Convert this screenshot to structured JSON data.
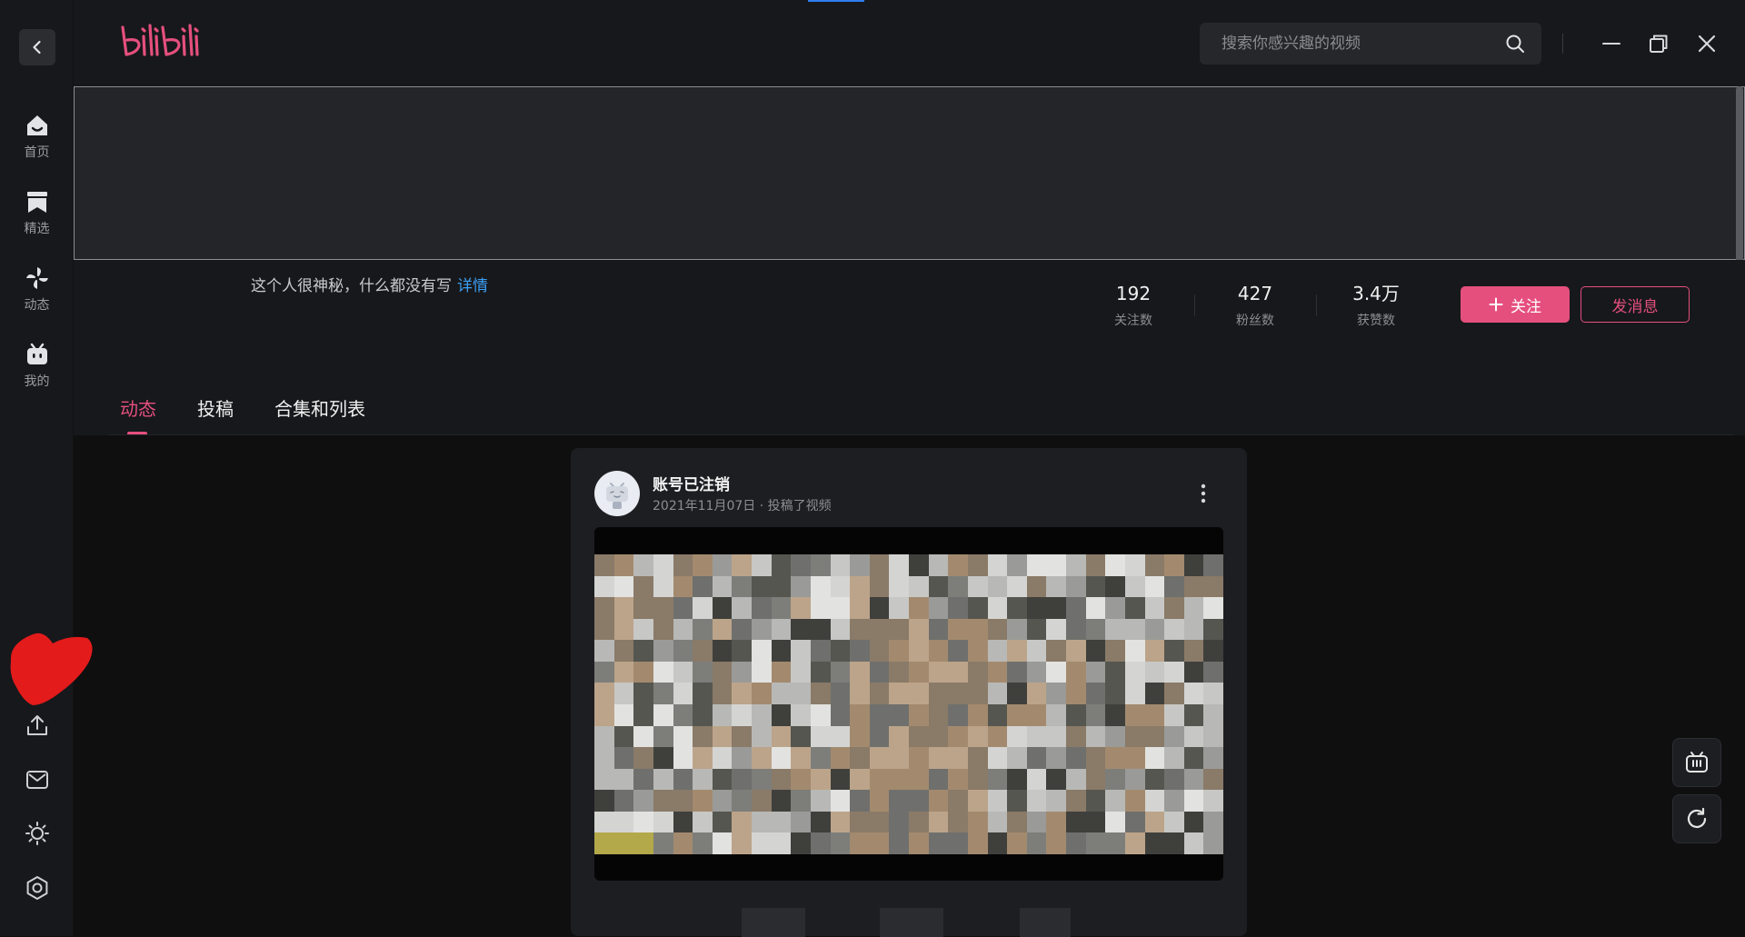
{
  "app": {
    "logo_text": "bilibili",
    "brand_color": "#e54f7e",
    "link_color": "#3b9ff5"
  },
  "sidebar": {
    "back_icon": "chevron-left-icon",
    "items": [
      {
        "label": "首页",
        "icon": "home-icon"
      },
      {
        "label": "精选",
        "icon": "bookmark-icon"
      },
      {
        "label": "动态",
        "icon": "pinwheel-icon"
      },
      {
        "label": "我的",
        "icon": "tv-icon"
      }
    ],
    "bottom_icons": [
      "upload-icon",
      "mail-icon",
      "sun-icon",
      "settings-icon"
    ]
  },
  "search": {
    "placeholder": "搜索你感兴趣的视频"
  },
  "profile": {
    "bio": "这个人很神秘，什么都没有写",
    "detail_link": "详情",
    "stats": [
      {
        "value": "192",
        "label": "关注数"
      },
      {
        "value": "427",
        "label": "粉丝数"
      },
      {
        "value": "3.4万",
        "label": "获赞数"
      }
    ],
    "follow_label": "关注",
    "message_label": "发消息"
  },
  "tabs": [
    {
      "label": "动态",
      "active": true
    },
    {
      "label": "投稿",
      "active": false
    },
    {
      "label": "合集和列表",
      "active": false
    }
  ],
  "feed": {
    "author": "账号已注销",
    "date": "2021年11月07日",
    "action": "投稿了视频"
  },
  "floating": {
    "icons": [
      "tv-icon",
      "refresh-icon"
    ]
  }
}
